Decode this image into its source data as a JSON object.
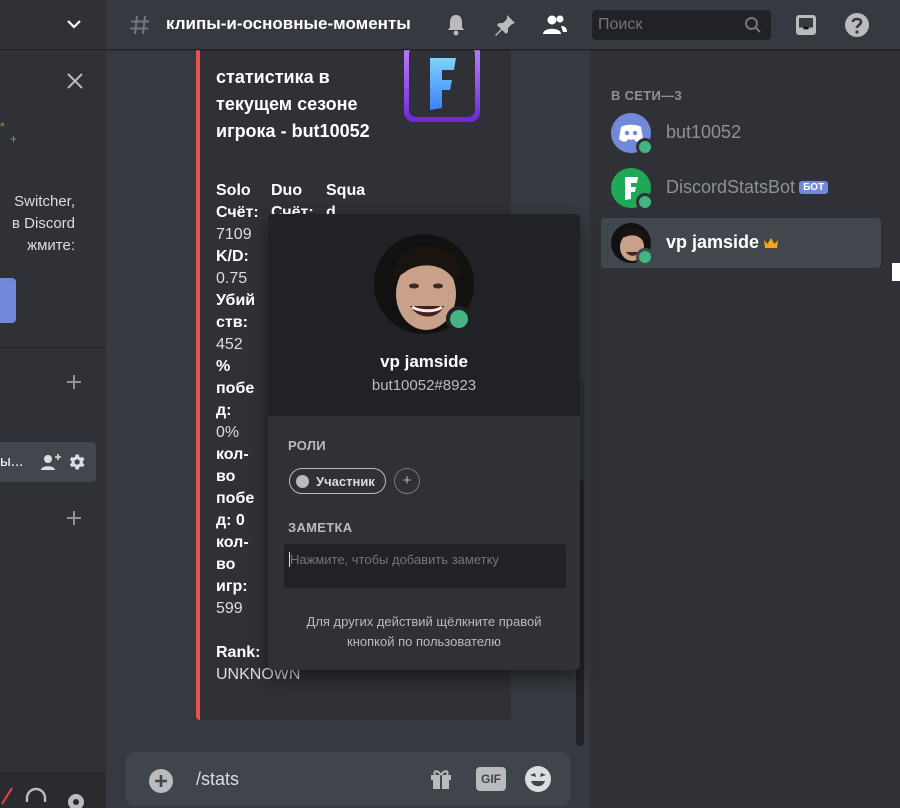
{
  "sidebar": {
    "promo_lines": [
      "Switcher,",
      "в Discord",
      "жмите:"
    ],
    "channel_label": "ы..."
  },
  "header": {
    "channel_name": "клипы-и-основные-моменты",
    "search_placeholder": "Поиск"
  },
  "embed": {
    "title": "статистика в текущем сезоне игрока - but10052",
    "columns": [
      {
        "header": "Solo",
        "lines": [
          {
            "t": "Счёт:",
            "b": true
          },
          {
            "t": "7109",
            "b": false
          },
          {
            "t": "K/D:",
            "b": true
          },
          {
            "t": "0.75",
            "b": false
          },
          {
            "t": "Убий",
            "b": true
          },
          {
            "t": "ств:",
            "b": true
          },
          {
            "t": "452",
            "b": false
          },
          {
            "t": "%",
            "b": true
          },
          {
            "t": "побе",
            "b": true
          },
          {
            "t": "д:",
            "b": true
          },
          {
            "t": "0%",
            "b": false
          },
          {
            "t": "кол-",
            "b": true
          },
          {
            "t": "во",
            "b": true
          },
          {
            "t": "побе",
            "b": true
          },
          {
            "t": "д: 0",
            "b": true
          },
          {
            "t": "кол-",
            "b": true
          },
          {
            "t": "во",
            "b": true
          },
          {
            "t": "игр:",
            "b": true
          },
          {
            "t": "599",
            "b": false
          }
        ]
      },
      {
        "header": "Duo",
        "lines": [
          {
            "t": "Счёт:",
            "b": true
          }
        ]
      },
      {
        "header": "Squa",
        "lines": [
          {
            "t": "d",
            "b": true
          }
        ]
      }
    ],
    "rank_label": "Rank:",
    "rank_value": "UNKNOWN"
  },
  "message_input": {
    "value": "/stats",
    "gif_label": "GIF"
  },
  "popout": {
    "username": "vp jamside",
    "tag": "but10052#8923",
    "roles_heading": "РОЛИ",
    "role_name": "Участник",
    "note_heading": "ЗАМЕТКА",
    "note_placeholder": "Нажмите, чтобы добавить заметку",
    "footer": "Для других действий щёлкните правой кнопкой по пользователю"
  },
  "members": {
    "heading": "В СЕТИ—3",
    "list": [
      {
        "name": "but10052",
        "bot": false,
        "owner": false
      },
      {
        "name": "DiscordStatsBot",
        "bot": true,
        "bot_label": "БОТ",
        "owner": false
      },
      {
        "name": "vp jamside",
        "bot": false,
        "owner": true
      }
    ]
  },
  "colors": {
    "accent": "#7289da",
    "online": "#43b581",
    "embed_bar": "#e8514f",
    "crown": "#faa61a"
  }
}
